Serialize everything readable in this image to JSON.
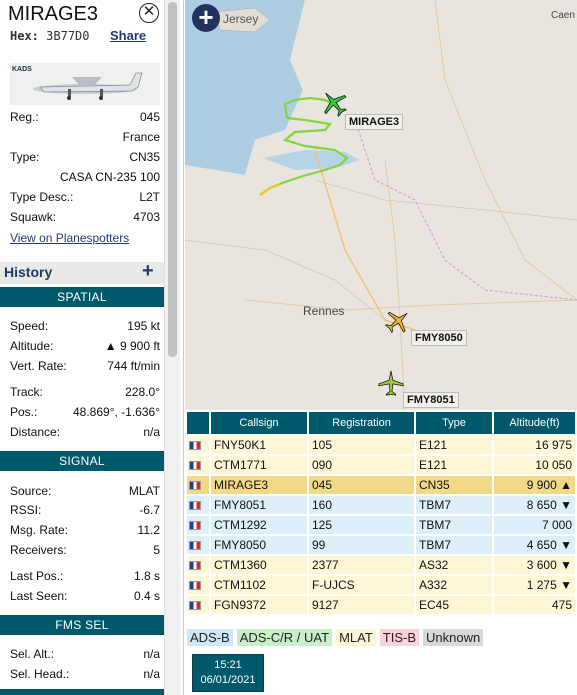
{
  "aircraft": {
    "callsign": "MIRAGE3",
    "hex_label": "Hex:",
    "hex": "3B77D0",
    "share": "Share",
    "photo_badge": "KADS",
    "reg_label": "Reg.:",
    "reg": "045",
    "country": "France",
    "type_label": "Type:",
    "type": "CN35",
    "type_full": "CASA CN-235 100",
    "type_desc_label": "Type Desc.:",
    "type_desc": "L2T",
    "squawk_label": "Squawk:",
    "squawk": "4703",
    "planespotters": "View on Planespotters"
  },
  "history": {
    "label": "History",
    "plus": "+"
  },
  "spatial": {
    "title": "SPATIAL",
    "speed_label": "Speed:",
    "speed": "195 kt",
    "altitude_label": "Altitude:",
    "altitude": "▲ 9 900 ft",
    "vrate_label": "Vert. Rate:",
    "vrate": "744 ft/min",
    "track_label": "Track:",
    "track": "228.0°",
    "pos_label": "Pos.:",
    "pos": "48.869°, -1.636°",
    "distance_label": "Distance:",
    "distance": "n/a"
  },
  "signal": {
    "title": "SIGNAL",
    "source_label": "Source:",
    "source": "MLAT",
    "rssi_label": "RSSI:",
    "rssi": "-6.7",
    "msgrate_label": "Msg. Rate:",
    "msgrate": "11.2",
    "receivers_label": "Receivers:",
    "receivers": "5",
    "lastpos_label": "Last Pos.:",
    "lastpos": "1.8 s",
    "lastseen_label": "Last Seen:",
    "lastseen": "0.4 s"
  },
  "fms": {
    "title": "FMS SEL",
    "alt_label": "Sel. Alt.:",
    "alt": "n/a",
    "head_label": "Sel. Head.:",
    "head": "n/a"
  },
  "map": {
    "places": [
      "Jersey",
      "Rennes",
      "Caen"
    ],
    "aircraft_labels": [
      "MIRAGE3",
      "FMY8050",
      "FMY8051"
    ],
    "colors": {
      "selected_plane": "#33cc33",
      "other_plane": "#f2b533",
      "track_green": "#7fd63d",
      "track_yellow": "#e6c91f"
    }
  },
  "table": {
    "headers": [
      "Callsign",
      "Registration",
      "Type",
      "Altitude(ft)"
    ],
    "rows": [
      {
        "callsign": "FNY50K1",
        "reg": "105",
        "type": "E121",
        "alt": "16 975",
        "cls": "y"
      },
      {
        "callsign": "CTM1771",
        "reg": "090",
        "type": "E121",
        "alt": "10 050",
        "cls": "y"
      },
      {
        "callsign": "MIRAGE3",
        "reg": "045",
        "type": "CN35",
        "alt": "9 900 ▲",
        "cls": "sel"
      },
      {
        "callsign": "FMY8051",
        "reg": "160",
        "type": "TBM7",
        "alt": "8 650 ▼",
        "cls": "b"
      },
      {
        "callsign": "CTM1292",
        "reg": "125",
        "type": "TBM7",
        "alt": "7 000",
        "cls": "b"
      },
      {
        "callsign": "FMY8050",
        "reg": "99",
        "type": "TBM7",
        "alt": "4 650 ▼",
        "cls": "b"
      },
      {
        "callsign": "CTM1360",
        "reg": "2377",
        "type": "AS32",
        "alt": "3 600 ▼",
        "cls": "y"
      },
      {
        "callsign": "CTM1102",
        "reg": "F-UJCS",
        "type": "A332",
        "alt": "1 275 ▼",
        "cls": "y"
      },
      {
        "callsign": "FGN9372",
        "reg": "9127",
        "type": "EC45",
        "alt": "475",
        "cls": "y"
      }
    ]
  },
  "legend": {
    "items": [
      {
        "label": "ADS-B",
        "color": "#cfe8f7"
      },
      {
        "label": "ADS-C/R / UAT",
        "color": "#c8f0c8"
      },
      {
        "label": "MLAT",
        "color": "#fdf7d8"
      },
      {
        "label": "TIS-B",
        "color": "#fbd2d8"
      },
      {
        "label": "Unknown",
        "color": "#d8d8d8"
      }
    ]
  },
  "timestamp": {
    "time": "15:21",
    "date": "06/01/2021"
  }
}
